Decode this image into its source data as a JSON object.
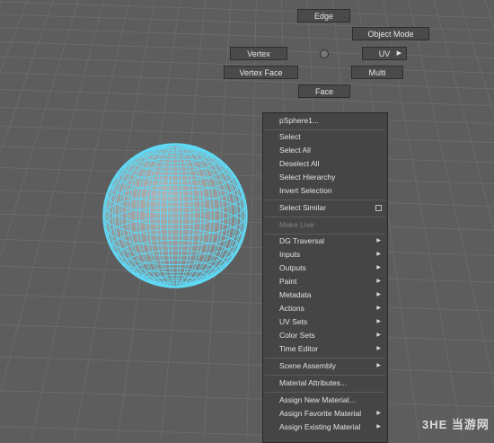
{
  "marking_menu": {
    "edge": "Edge",
    "object_mode": "Object Mode",
    "vertex": "Vertex",
    "uv": "UV",
    "vertex_face": "Vertex Face",
    "multi": "Multi",
    "face": "Face"
  },
  "context_menu": {
    "header": "pSphere1...",
    "select": "Select",
    "select_all": "Select All",
    "deselect_all": "Deselect All",
    "select_hierarchy": "Select Hierarchy",
    "invert_selection": "Invert Selection",
    "select_similar": "Select Similar",
    "make_live": "Make Live",
    "dg_traversal": "DG Traversal",
    "inputs": "Inputs",
    "outputs": "Outputs",
    "paint": "Paint",
    "metadata": "Metadata",
    "actions": "Actions",
    "uv_sets": "UV Sets",
    "color_sets": "Color Sets",
    "time_editor": "Time Editor",
    "scene_assembly": "Scene Assembly",
    "material_attributes": "Material Attributes...",
    "assign_new_material": "Assign New Material...",
    "assign_favorite_material": "Assign Favorite Material",
    "assign_existing_material": "Assign Existing Material"
  },
  "watermark": "3HE 当游网",
  "colors": {
    "viewport": "#5d5d5d",
    "wireframe": "#5fd9f5",
    "menu_bg": "#454545"
  },
  "icons": {
    "submenu": "submenu-arrow-icon",
    "option_box": "option-box-icon"
  }
}
